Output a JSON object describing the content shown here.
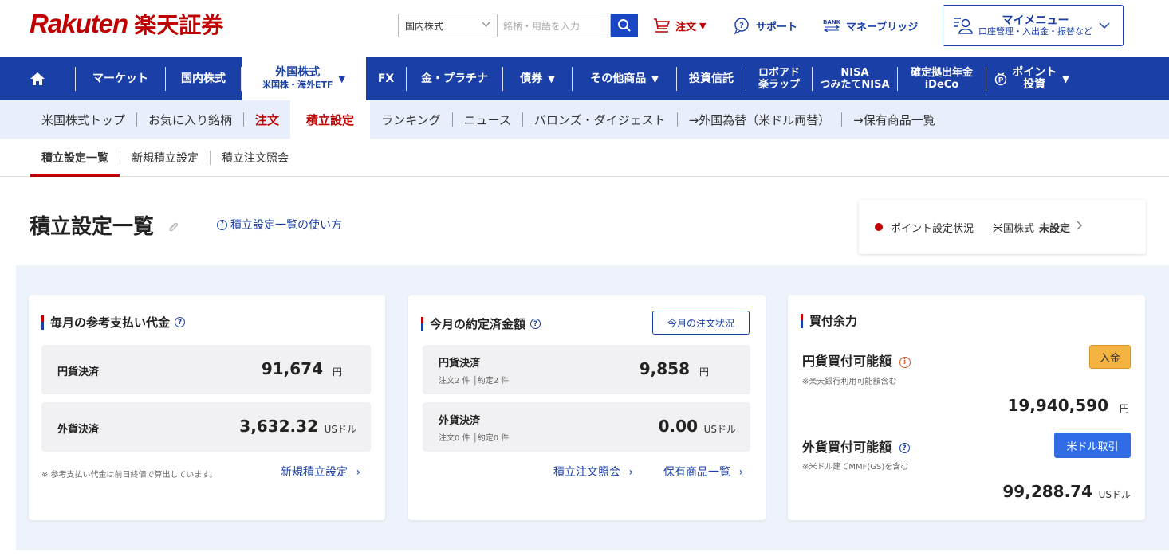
{
  "header": {
    "logo_brand": "Rakuten",
    "logo_jp": "楽天証券",
    "search_category": "国内株式",
    "search_placeholder": "銘柄・用語を入力",
    "order_label": "注文",
    "support_label": "サポート",
    "bank_small": "BANK",
    "money_bridge_label": "マネーブリッジ",
    "my_menu_title": "マイメニュー",
    "my_menu_sub": "口座管理・入出金・振替など"
  },
  "nav": {
    "items": [
      {
        "label": "マーケット"
      },
      {
        "label": "国内株式"
      },
      {
        "label": "外国株式",
        "sub": "米国株・海外ETF"
      },
      {
        "label": "FX"
      },
      {
        "label": "金・プラチナ"
      },
      {
        "label": "債券"
      },
      {
        "label": "その他商品"
      },
      {
        "label": "投資信託"
      },
      {
        "label": "ロボアド",
        "sub": "楽ラップ"
      },
      {
        "label": "NISA",
        "sub": "つみたてNISA"
      },
      {
        "label": "確定拠出年金",
        "sub": "iDeCo"
      },
      {
        "label": "ポイント",
        "sub": "投資"
      }
    ]
  },
  "subnav": {
    "items": [
      "米国株式トップ",
      "お気に入り銘柄",
      "注文",
      "積立設定",
      "ランキング",
      "ニュース",
      "バロンズ・ダイジェスト",
      "→外国為替（米ドル両替）",
      "→保有商品一覧"
    ]
  },
  "tabs": [
    "積立設定一覧",
    "新規積立設定",
    "積立注文照会"
  ],
  "page": {
    "title": "積立設定一覧",
    "help_link": "積立設定一覧の使い方",
    "point_status_label": "ポイント設定状況",
    "point_status_market": "米国株式",
    "point_status_value": "未設定"
  },
  "card1": {
    "title": "毎月の参考支払い代金",
    "yen_label": "円貨決済",
    "yen_value": "91,674",
    "yen_unit": "円",
    "fx_label": "外貨決済",
    "fx_value": "3,632.32",
    "fx_unit": "USドル",
    "note": "※ 参考支払い代金は前日終値で算出しています。",
    "link": "新規積立設定"
  },
  "card2": {
    "title": "今月の約定済金額",
    "order_status_btn": "今月の注文状況",
    "yen_label": "円貨決済",
    "yen_sub_order": "注文2 件",
    "yen_sub_exec": "約定2 件",
    "yen_value": "9,858",
    "yen_unit": "円",
    "fx_label": "外貨決済",
    "fx_sub_order": "注文0 件",
    "fx_sub_exec": "約定0 件",
    "fx_value": "0.00",
    "fx_unit": "USドル",
    "link1": "積立注文照会",
    "link2": "保有商品一覧"
  },
  "card3": {
    "title": "買付余力",
    "yen_title": "円貨買付可能額",
    "yen_note": "※楽天銀行利用可能額含む",
    "deposit_btn": "入金",
    "yen_value": "19,940,590",
    "yen_unit": "円",
    "fx_title": "外貨買付可能額",
    "fx_note": "※米ドル建てMMF(GS)を含む",
    "usd_btn": "米ドル取引",
    "fx_value": "99,288.74",
    "fx_unit": "USドル"
  }
}
